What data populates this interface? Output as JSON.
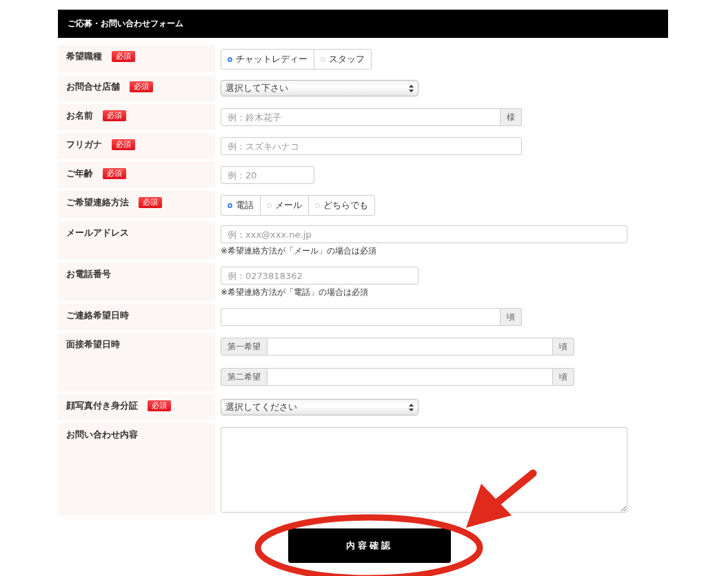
{
  "form": {
    "title": "ご応募・お問い合わせフォーム",
    "rows": [
      {
        "label": "希望職種",
        "badge": "必須",
        "kind": "radios",
        "options": [
          {
            "label": "チャットレディー",
            "selected": true
          },
          {
            "label": "スタッフ",
            "selected": false
          }
        ]
      },
      {
        "label": "お問合せ店舗",
        "badge": "必須",
        "kind": "select",
        "value": "選択して下さい"
      },
      {
        "label": "お名前",
        "badge": "必須",
        "kind": "text",
        "placeholder": "例：鈴木花子",
        "suffix": "様"
      },
      {
        "label": "フリガナ",
        "badge": "必須",
        "kind": "text",
        "placeholder": "例：スズキハナコ"
      },
      {
        "label": "ご年齢",
        "badge": "必須",
        "kind": "text",
        "placeholder": "例：20"
      },
      {
        "label": "ご希望連絡方法",
        "badge": "必須",
        "kind": "radios",
        "options": [
          {
            "label": "電話",
            "selected": true
          },
          {
            "label": "メール",
            "selected": false
          },
          {
            "label": "どちらでも",
            "selected": false
          }
        ]
      },
      {
        "label": "メールアドレス",
        "kind": "text",
        "placeholder": "例：xxx@xxx.ne.jp",
        "note": "※希望連絡方法が「メール」の場合は必須"
      },
      {
        "label": "お電話番号",
        "kind": "text",
        "placeholder": "例：0273818362",
        "note": "※希望連絡方法が「電話」の場合は必須"
      },
      {
        "label": "ご連絡希望日時",
        "kind": "text",
        "suffix": "頃"
      },
      {
        "label": "面接希望日時",
        "kind": "multi",
        "inputs": [
          {
            "prefix": "第一希望",
            "suffix": "頃"
          },
          {
            "prefix": "第二希望",
            "suffix": "頃"
          }
        ]
      },
      {
        "label": "顔写真付き身分証",
        "badge": "必須",
        "kind": "select",
        "value": "選択してください"
      },
      {
        "label": "お問い合わせ内容",
        "kind": "textarea"
      }
    ],
    "submit": "内容確認"
  }
}
